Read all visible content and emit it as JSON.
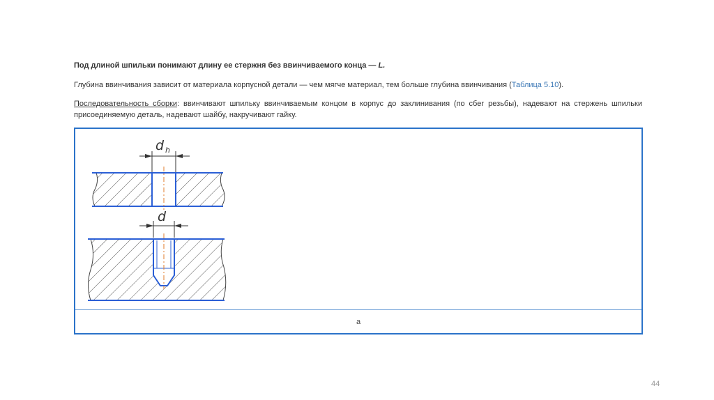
{
  "paragraphs": {
    "p1_text": "Под длиной шпильки понимают длину ее стержня без ввинчиваемого конца — ",
    "p1_symbol": "L.",
    "p2_text": "Глубина ввинчивания зависит от материала корпусной детали — чем мягче материал, тем больше глубина ввинчивания (",
    "p2_link": "Таблица 5.10",
    "p2_end": ").",
    "p3_term": "Последовательность сборки",
    "p3_text": ": ввинчивают шпильку ввинчиваемым концом в корпус до заклинивания (по сбег резьбы), надевают на стержень шпильки присоединяемую деталь, надевают шайбу, накручивают гайку."
  },
  "figure": {
    "label_dh_main": "d",
    "label_dh_sub": "h",
    "label_d": "d",
    "caption": "а"
  },
  "page_number": "44",
  "colors": {
    "outline": "#2b5fd6",
    "hatch": "#555555",
    "axis": "#e07b2a",
    "frame": "#2b73c9",
    "link": "#3a77b5"
  }
}
